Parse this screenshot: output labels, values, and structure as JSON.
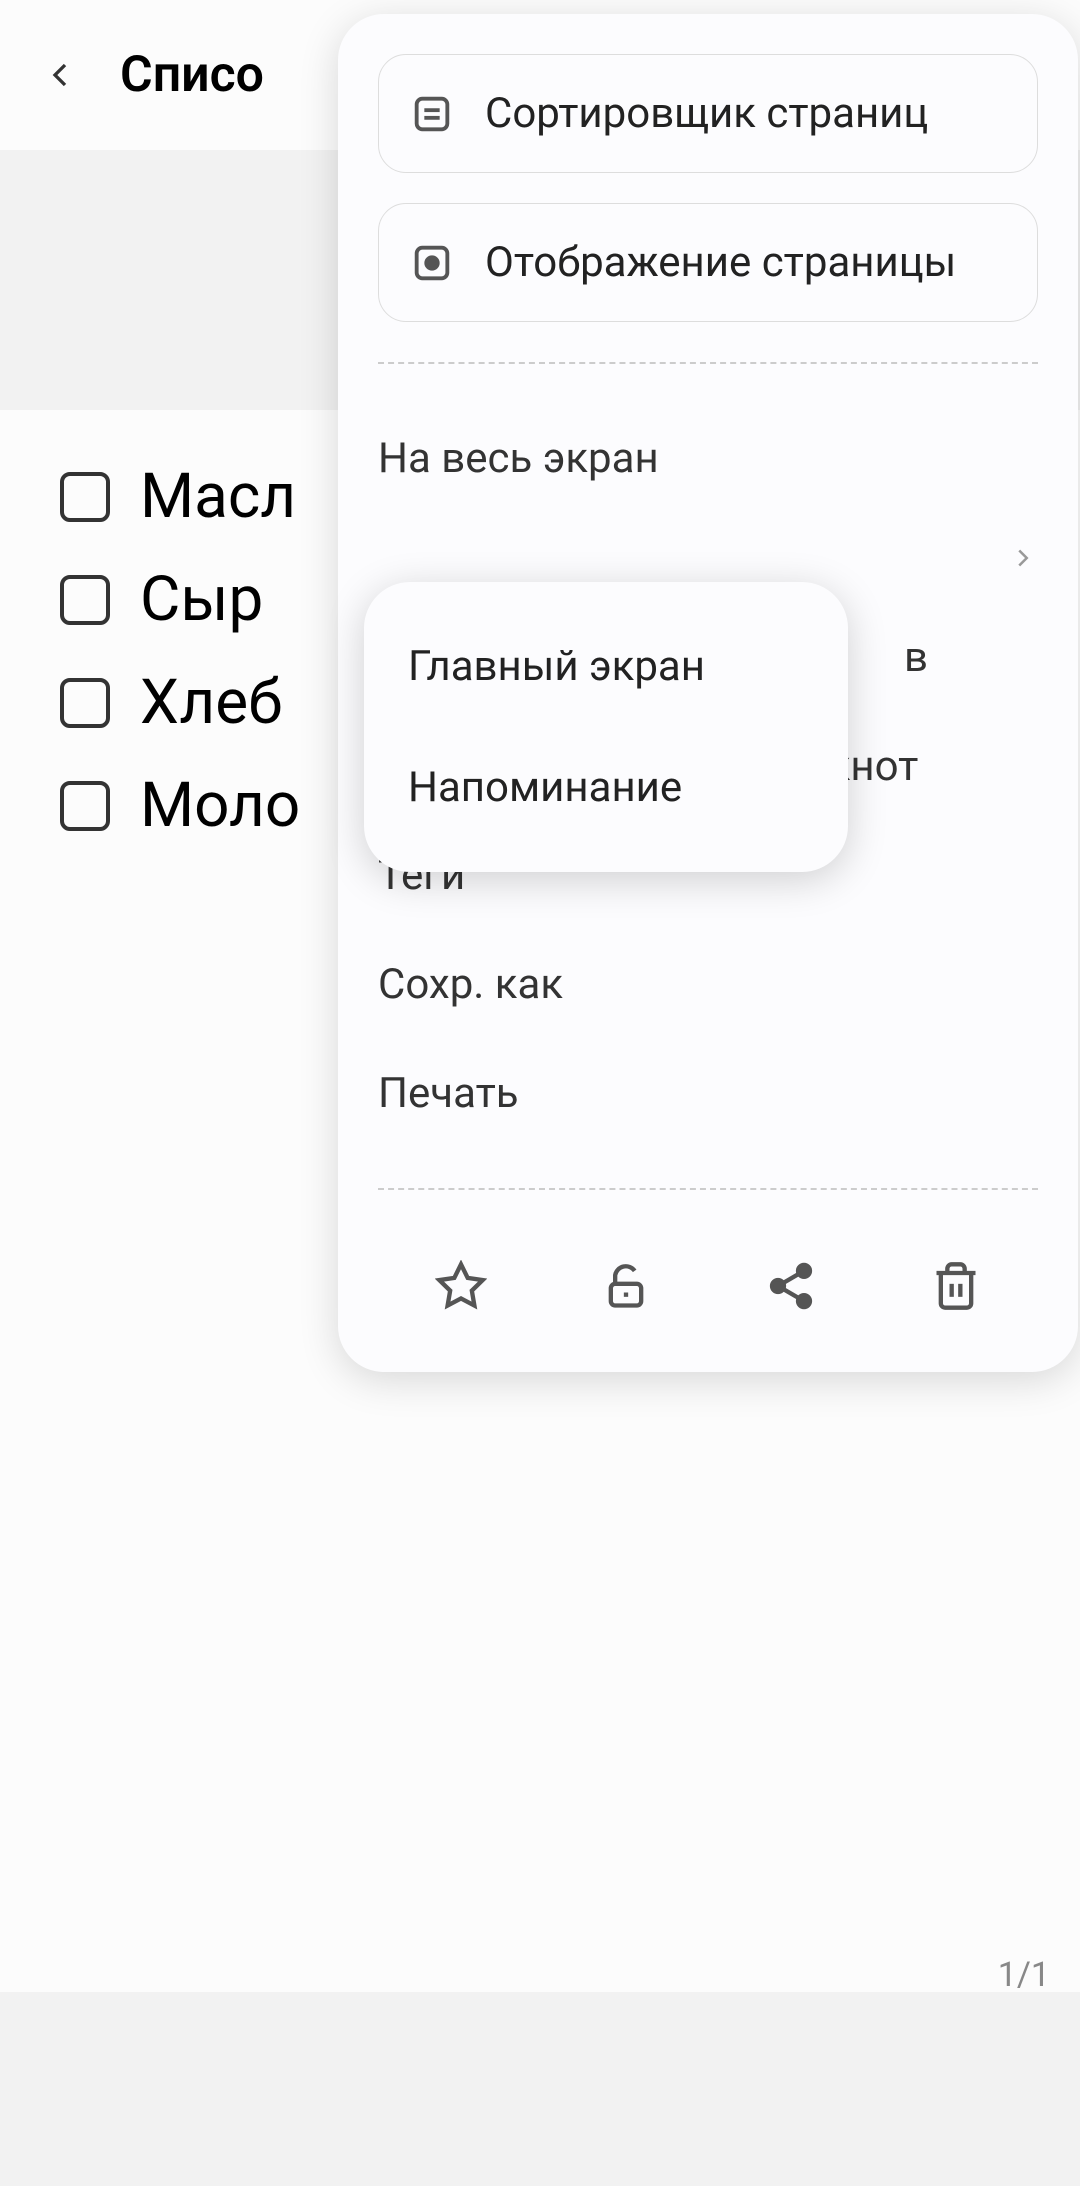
{
  "header": {
    "title": "Списо"
  },
  "checklist": {
    "items": [
      {
        "label": "Масл"
      },
      {
        "label": "Сыр"
      },
      {
        "label": "Хлеб"
      },
      {
        "label": "Моло"
      }
    ]
  },
  "page_counter": "1/1",
  "menu": {
    "cards": [
      {
        "label": "Сортировщик страниц",
        "icon": "page-sorter"
      },
      {
        "label": "Отображение страницы",
        "icon": "page-display"
      }
    ],
    "items": [
      {
        "label": "На весь экран",
        "has_chevron": false
      },
      {
        "label": "",
        "has_chevron": true
      },
      {
        "label": "в",
        "has_chevron": false
      },
      {
        "label": "Добавить в общий блокнот",
        "has_chevron": false
      },
      {
        "label": "Теги",
        "has_chevron": false
      },
      {
        "label": "Сохр. как",
        "has_chevron": false
      },
      {
        "label": "Печать",
        "has_chevron": false
      }
    ]
  },
  "submenu": {
    "items": [
      {
        "label": "Главный экран"
      },
      {
        "label": "Напоминание"
      }
    ]
  }
}
